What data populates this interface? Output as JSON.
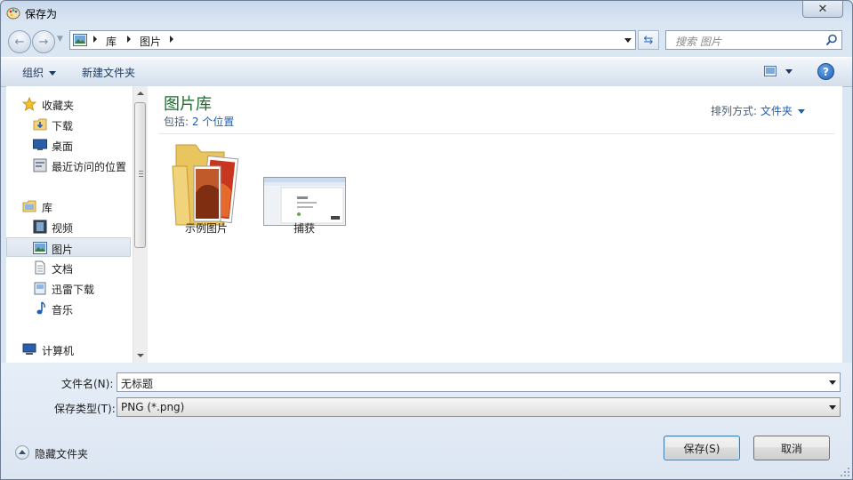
{
  "window": {
    "title": "保存为"
  },
  "navigation": {
    "breadcrumb": [
      "库",
      "图片"
    ],
    "search_placeholder": "搜索 图片"
  },
  "toolbar": {
    "organize_label": "组织",
    "new_folder_label": "新建文件夹",
    "help_glyph": "?"
  },
  "sidebar": {
    "favorites_label": "收藏夹",
    "favorites": [
      "下载",
      "桌面",
      "最近访问的位置"
    ],
    "libraries_label": "库",
    "libraries": [
      "视频",
      "图片",
      "文档",
      "迅雷下载",
      "音乐"
    ],
    "selected": "图片",
    "computer_label": "计算机"
  },
  "content": {
    "library_title": "图片库",
    "includes_prefix": "包括:",
    "includes_link": "2 个位置",
    "arrange_label": "排列方式:",
    "arrange_value": "文件夹",
    "items": [
      {
        "name": "示例图片",
        "kind": "folder"
      },
      {
        "name": "捕获",
        "kind": "image"
      }
    ]
  },
  "form": {
    "filename_label": "文件名(N):",
    "filename_value": "无标题",
    "filetype_label": "保存类型(T):",
    "filetype_value": "PNG (*.png)"
  },
  "footer": {
    "hide_folders_label": "隐藏文件夹",
    "save_label": "保存(S)",
    "cancel_label": "取消"
  },
  "colors": {
    "accent": "#1c5fb4",
    "library_title": "#1e6a2e",
    "frame": "#dbe6f3"
  }
}
